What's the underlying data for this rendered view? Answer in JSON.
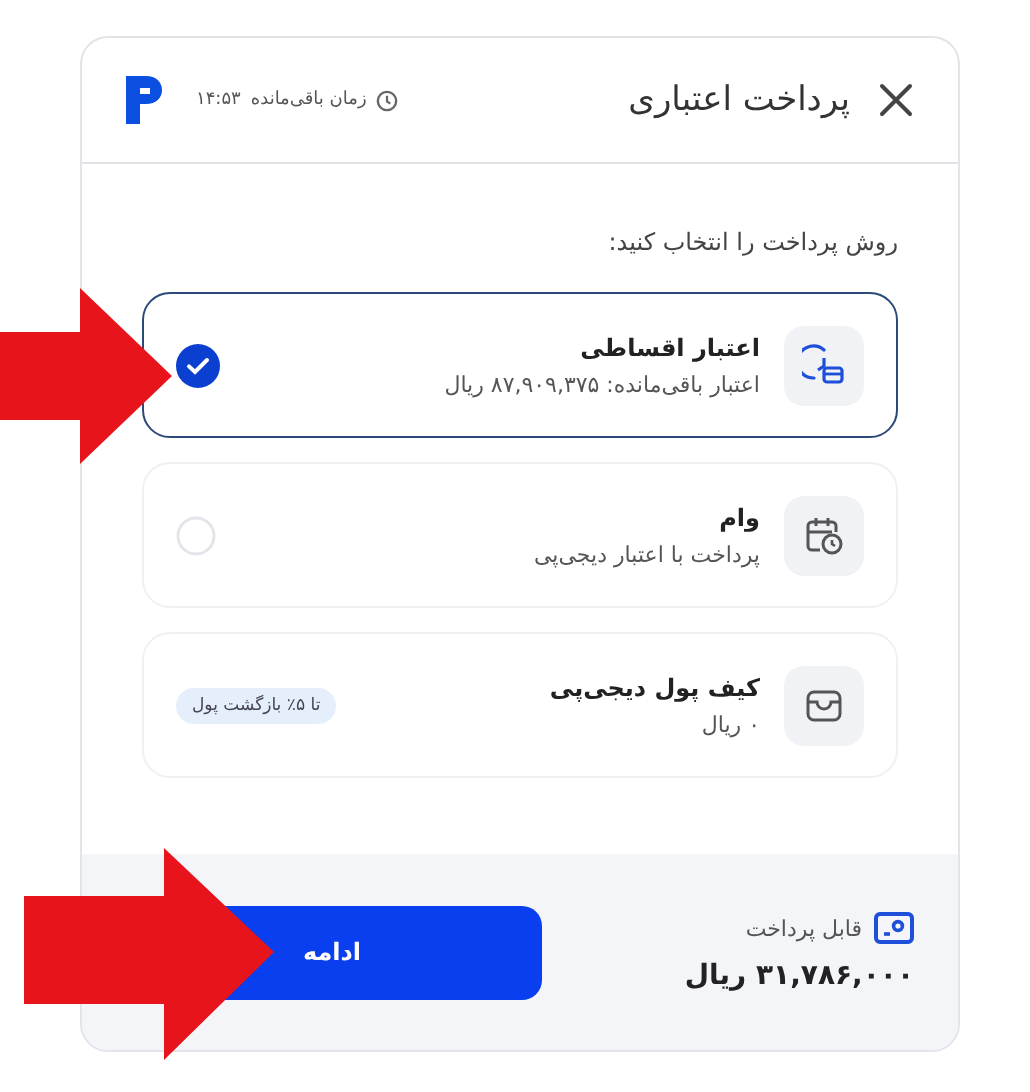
{
  "header": {
    "title": "پرداخت اعتباری",
    "timer_label": "زمان باقی‌مانده",
    "timer": "۱۴:۵۳"
  },
  "prompt": "روش پرداخت را انتخاب کنید:",
  "options": [
    {
      "kind": "installment",
      "title": "اعتبار اقساطی",
      "subtitle": "اعتبار باقی‌مانده: ۸۷,۹۰۹,۳۷۵ ریال",
      "selected": true
    },
    {
      "kind": "loan",
      "title": "وام",
      "subtitle": "پرداخت با اعتبار دیجی‌پی",
      "selected": false
    },
    {
      "kind": "wallet",
      "title": "کیف پول دیجی‌پی",
      "subtitle": "۰ ریال",
      "badge": "تا ۵٪ بازگشت پول"
    }
  ],
  "footer": {
    "label": "قابل پرداخت",
    "amount": "۳۱,۷۸۶,۰۰۰ ریال",
    "button": "ادامه"
  }
}
